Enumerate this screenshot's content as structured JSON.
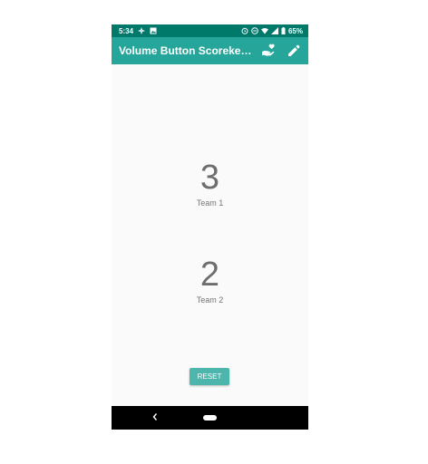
{
  "status_bar": {
    "time": "5:34",
    "battery": "65%",
    "icons_left": [
      "fan-icon",
      "image-icon"
    ],
    "icons_right": [
      "alarm-icon",
      "do-not-disturb-icon",
      "wifi-icon",
      "signal-icon",
      "battery-icon"
    ],
    "color": "#00796b"
  },
  "app_bar": {
    "title": "Volume Button Scorekeeper…",
    "color": "#26a69a",
    "actions": [
      "donate-hand-heart-icon",
      "edit-pencil-icon"
    ]
  },
  "teams": [
    {
      "score": "3",
      "label": "Team 1"
    },
    {
      "score": "2",
      "label": "Team 2"
    }
  ],
  "reset_button": {
    "label": "RESET",
    "color": "#4db6ac"
  },
  "nav_bar": {
    "back_icon": "back-chevron-icon",
    "home_icon": "home-pill-icon"
  }
}
